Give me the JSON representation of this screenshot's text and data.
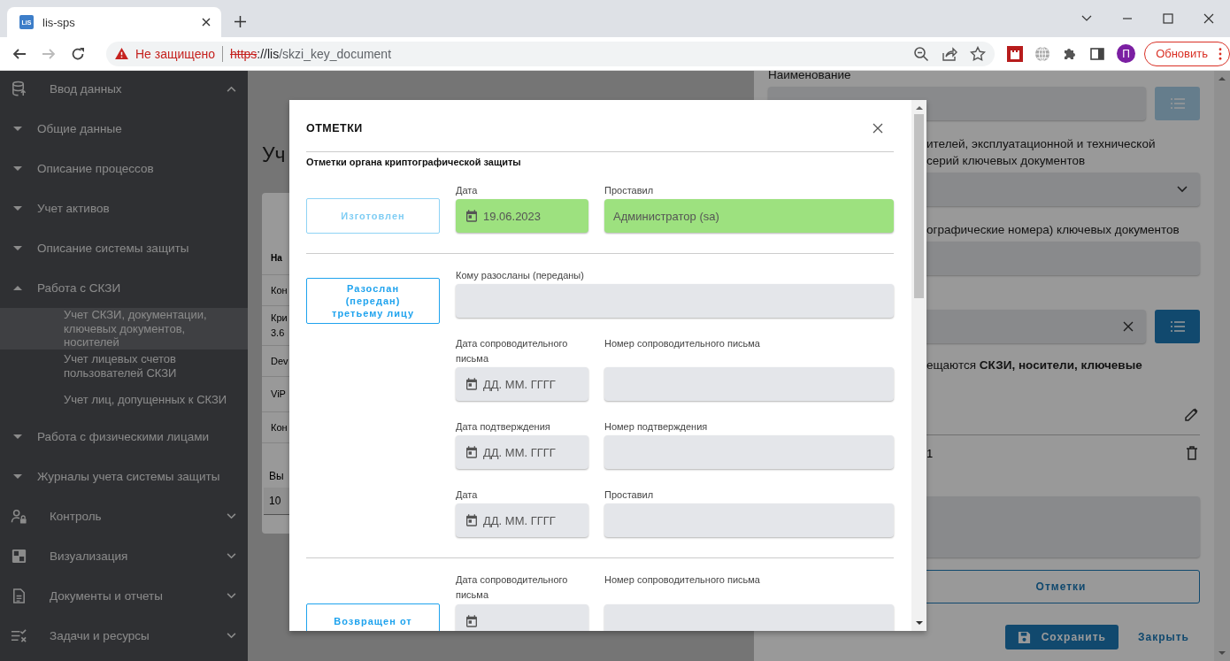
{
  "browser": {
    "tab": {
      "favicon": "LiS",
      "title": "lis-sps"
    },
    "security": "Не защищено",
    "url_parts": [
      {
        "kind": "insecure-scheme",
        "text": "https"
      },
      {
        "kind": "host",
        "text": "://lis"
      },
      {
        "kind": "path",
        "text": "/skzi_key_document"
      }
    ],
    "profile_initial": "П",
    "update_button": "Обновить"
  },
  "sidebar": {
    "items": [
      {
        "label": "Ввод данных",
        "expanded": true,
        "children": [
          {
            "label": "Общие данные",
            "expanded": false
          },
          {
            "label": "Описание процессов",
            "expanded": false
          },
          {
            "label": "Учет активов",
            "expanded": false
          },
          {
            "label": "Описание системы защиты",
            "expanded": false
          },
          {
            "label": "Работа с СКЗИ",
            "expanded": true,
            "children": [
              {
                "label": "Учет СКЗИ, документации, ключевых документов, носителей",
                "selected": true
              },
              {
                "label": "Учет лицевых счетов пользователей СКЗИ",
                "selected": false
              },
              {
                "label": "Учет лиц, допущенных к СКЗИ",
                "selected": false
              }
            ]
          },
          {
            "label": "Работа с физическими лицами",
            "expanded": false
          },
          {
            "label": "Журналы учета системы защиты",
            "expanded": false
          }
        ]
      },
      {
        "label": "Контроль",
        "expanded": false
      },
      {
        "label": "Визуализация",
        "expanded": false
      },
      {
        "label": "Документы и отчеты",
        "expanded": false
      },
      {
        "label": "Задачи и ресурсы",
        "expanded": false
      }
    ]
  },
  "main": {
    "heading": "Уч",
    "table": {
      "header": "На",
      "rows": [
        "Кон",
        "Кри\n3.6",
        "Dev",
        "ViP",
        "Кон"
      ]
    },
    "page_size_label": "Вы",
    "page_size": "10"
  },
  "right_panel": {
    "rows": [
      {
        "kind": "label",
        "text": "Наименование"
      },
      {
        "kind": "field-with-list",
        "disabled": true,
        "clearable": false
      },
      {
        "kind": "cut-label",
        "text": "ителей, эксплуатационной и технической\nсерий ключевых документов"
      },
      {
        "kind": "select"
      },
      {
        "kind": "cut-label",
        "text": "ографические номера) ключевых документов"
      },
      {
        "kind": "field"
      },
      {
        "kind": "field-with-list",
        "disabled": false,
        "clearable": true
      },
      {
        "kind": "cut-text",
        "text": "ещаются **СКЗИ, носители, ключевые**"
      },
      {
        "kind": "edit-row"
      },
      {
        "kind": "list-row",
        "text": "1"
      },
      {
        "kind": "textarea"
      },
      {
        "kind": "outline-button",
        "text": "Отметки"
      },
      {
        "kind": "actions",
        "save": "Сохранить",
        "close": "Закрыть"
      }
    ]
  },
  "dialog": {
    "title": "ОТМЕТКИ",
    "subtitle": "Отметки органа криптографической защиты",
    "sections": [
      {
        "button": "Изготовлен",
        "disabled": true,
        "done": true,
        "rows": [
          {
            "fields": [
              {
                "label": "Дата",
                "kind": "date",
                "value": "19.06.2023"
              },
              {
                "label": "Проставил",
                "kind": "text",
                "value": "Администратор (sa)"
              }
            ]
          }
        ]
      },
      {
        "button": "Разослан (передан) третьему лицу",
        "disabled": false,
        "done": false,
        "rows": [
          {
            "fields": [
              {
                "label": "Кому разосланы (переданы)",
                "kind": "wide-text"
              }
            ]
          },
          {
            "fields": [
              {
                "label": "Дата сопроводительного письма",
                "kind": "date",
                "placeholder": "ДД. ММ. ГГГГ"
              },
              {
                "label": "Номер сопроводительного письма",
                "kind": "text"
              }
            ]
          },
          {
            "fields": [
              {
                "label": "Дата подтверждения",
                "kind": "date",
                "placeholder": "ДД. ММ. ГГГГ"
              },
              {
                "label": "Номер подтверждения",
                "kind": "text"
              }
            ]
          },
          {
            "fields": [
              {
                "label": "Дата",
                "kind": "date",
                "placeholder": "ДД. ММ. ГГГГ"
              },
              {
                "label": "Проставил",
                "kind": "text"
              }
            ]
          }
        ]
      },
      {
        "button": "Возвращен от",
        "disabled": false,
        "done": false,
        "rows": [
          {
            "fields": [
              {
                "label": "Дата сопроводительного письма",
                "kind": "date"
              },
              {
                "label": "Номер сопроводительного письма",
                "kind": "text"
              }
            ]
          }
        ]
      }
    ]
  }
}
